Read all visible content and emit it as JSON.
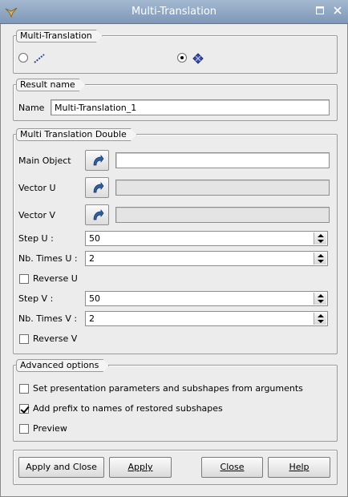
{
  "window": {
    "title": "Multi-Translation"
  },
  "type_group": {
    "title": "Multi-Translation",
    "options": [
      "simple",
      "double"
    ],
    "selected": "double"
  },
  "result": {
    "title": "Result name",
    "name_label": "Name",
    "name_value": "Multi-Translation_1"
  },
  "params": {
    "title": "Multi Translation Double",
    "main_object_label": "Main Object",
    "main_object_value": "",
    "vector_u_label": "Vector U",
    "vector_u_value": "",
    "vector_v_label": "Vector V",
    "vector_v_value": "",
    "step_u_label": "Step U :",
    "step_u_value": "50",
    "nb_times_u_label": "Nb. Times U :",
    "nb_times_u_value": "2",
    "reverse_u_label": "Reverse U",
    "reverse_u_checked": false,
    "step_v_label": "Step V :",
    "step_v_value": "50",
    "nb_times_v_label": "Nb. Times V :",
    "nb_times_v_value": "2",
    "reverse_v_label": "Reverse V",
    "reverse_v_checked": false
  },
  "advanced": {
    "title": "Advanced options",
    "set_presentation_label": "Set presentation parameters and subshapes from arguments",
    "set_presentation_checked": false,
    "add_prefix_label": "Add prefix to names of restored subshapes",
    "add_prefix_checked": true,
    "preview_label": "Preview",
    "preview_checked": false
  },
  "buttons": {
    "apply_close": "Apply and Close",
    "apply": "Apply",
    "close": "Close",
    "help": "Help"
  },
  "icons": {
    "window_icon": "bird-icon",
    "maximize_icon": "maximize-icon",
    "close_icon": "close-icon",
    "selection_icon": "selection-arrow-icon",
    "simple_translation_icon": "line-translation-icon",
    "double_translation_icon": "grid-translation-icon"
  }
}
